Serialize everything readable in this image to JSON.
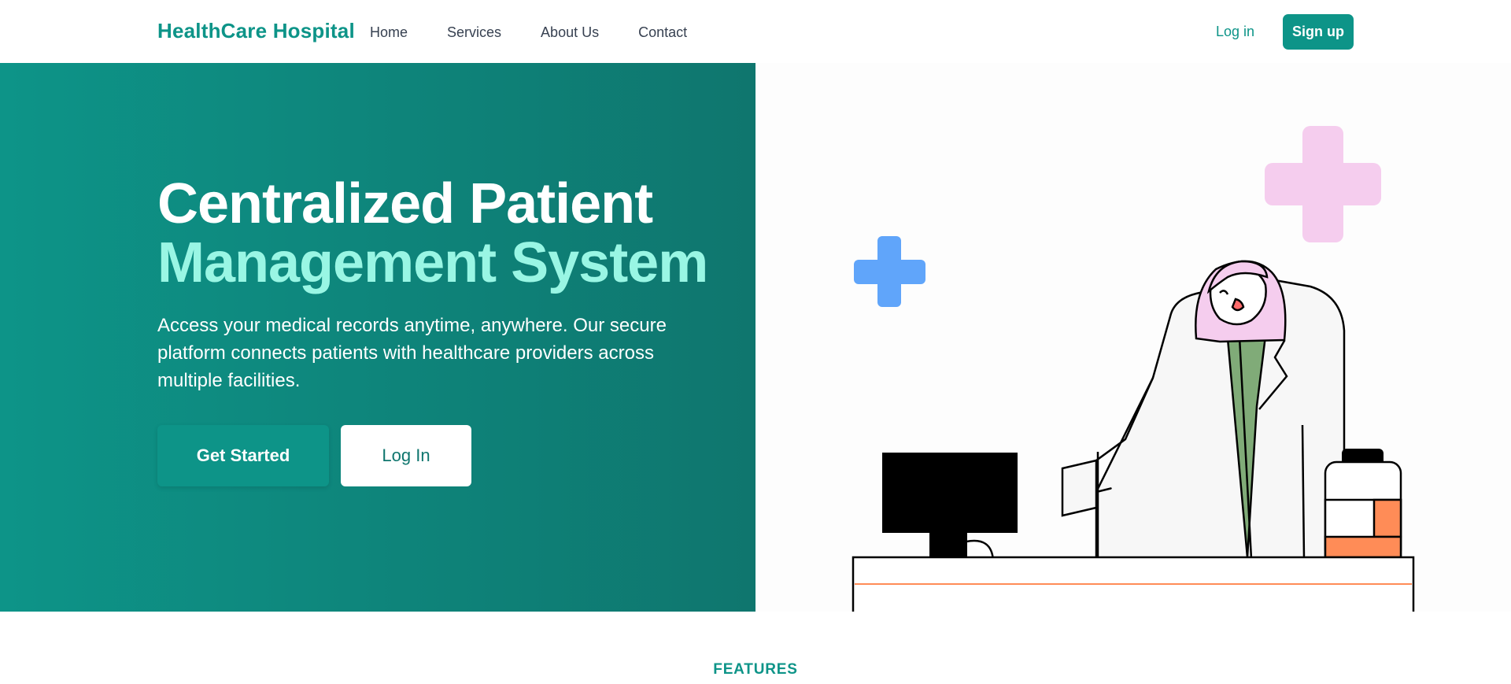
{
  "nav": {
    "brand": "HealthCare Hospital",
    "links": [
      "Home",
      "Services",
      "About Us",
      "Contact"
    ],
    "login": "Log in",
    "signup": "Sign up"
  },
  "hero": {
    "title_line1": "Centralized Patient",
    "title_line2": "Management System",
    "description": "Access your medical records anytime, anywhere. Our secure platform connects patients with healthcare providers across multiple facilities.",
    "primary_button": "Get Started",
    "secondary_button": "Log In"
  },
  "illustration": {
    "icons": [
      "pink-cross-icon",
      "blue-cross-icon",
      "doctor-illustration",
      "computer-monitor-icon",
      "medicine-bottle-icon"
    ]
  },
  "features": {
    "label": "FEATURES"
  },
  "colors": {
    "brand": "#0d9488",
    "brand_dark": "#0f766e",
    "accent_mint": "#99f6e4",
    "cross_pink": "#f5cdee",
    "cross_blue": "#60a5fa",
    "bottle_orange": "#ff8c57",
    "scrubs_green": "#80ab78"
  }
}
